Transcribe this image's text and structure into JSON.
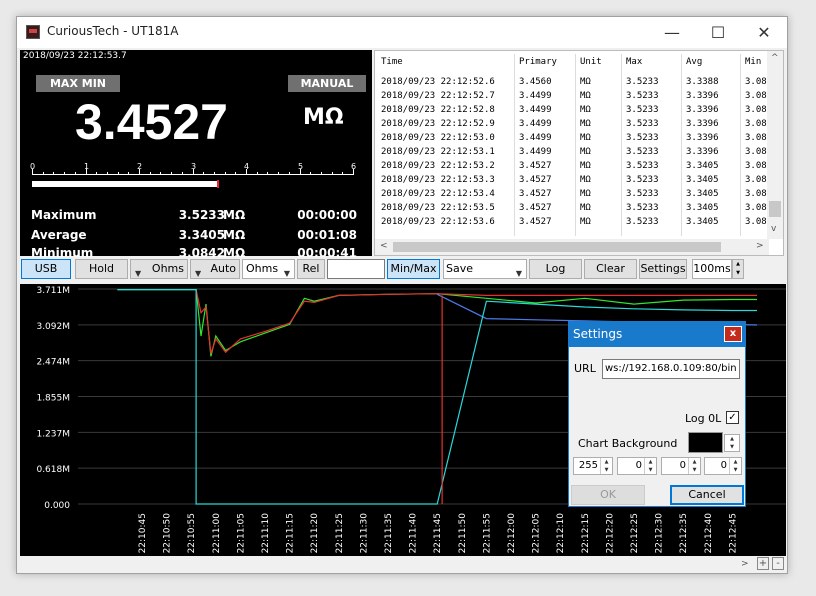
{
  "window": {
    "title": "CuriousTech - UT181A",
    "minimize": "—",
    "maximize": "☐",
    "close": "✕"
  },
  "meter": {
    "timestamp": "2018/09/23 22:12:53.7",
    "mode_badge": "MAX MIN",
    "range_badge": "MANUAL",
    "value": "3.4527",
    "unit": "MΩ",
    "scale_labels": [
      "0",
      "1",
      "2",
      "3",
      "4",
      "5",
      "6"
    ],
    "bargraph_fraction": 0.575,
    "stats": [
      {
        "label": "Maximum",
        "value": "3.5233",
        "unit": "MΩ",
        "time": "00:00:00"
      },
      {
        "label": "Average",
        "value": "3.3405",
        "unit": "MΩ",
        "time": "00:01:08"
      },
      {
        "label": "Minimum",
        "value": "3.0842",
        "unit": "MΩ",
        "time": "00:00:41"
      }
    ]
  },
  "table": {
    "columns": [
      "Time",
      "Primary",
      "Unit",
      "Max",
      "Avg",
      "Min"
    ],
    "rows": [
      [
        "2018/09/23 22:12:52.6",
        "3.4560",
        "MΩ",
        "3.5233",
        "3.3388",
        "3.08"
      ],
      [
        "2018/09/23 22:12:52.7",
        "3.4499",
        "MΩ",
        "3.5233",
        "3.3396",
        "3.08"
      ],
      [
        "2018/09/23 22:12:52.8",
        "3.4499",
        "MΩ",
        "3.5233",
        "3.3396",
        "3.08"
      ],
      [
        "2018/09/23 22:12:52.9",
        "3.4499",
        "MΩ",
        "3.5233",
        "3.3396",
        "3.08"
      ],
      [
        "2018/09/23 22:12:53.0",
        "3.4499",
        "MΩ",
        "3.5233",
        "3.3396",
        "3.08"
      ],
      [
        "2018/09/23 22:12:53.1",
        "3.4499",
        "MΩ",
        "3.5233",
        "3.3396",
        "3.08"
      ],
      [
        "2018/09/23 22:12:53.2",
        "3.4527",
        "MΩ",
        "3.5233",
        "3.3405",
        "3.08"
      ],
      [
        "2018/09/23 22:12:53.3",
        "3.4527",
        "MΩ",
        "3.5233",
        "3.3405",
        "3.08"
      ],
      [
        "2018/09/23 22:12:53.4",
        "3.4527",
        "MΩ",
        "3.5233",
        "3.3405",
        "3.08"
      ],
      [
        "2018/09/23 22:12:53.5",
        "3.4527",
        "MΩ",
        "3.5233",
        "3.3405",
        "3.08"
      ],
      [
        "2018/09/23 22:12:53.6",
        "3.4527",
        "MΩ",
        "3.5233",
        "3.3405",
        "3.08"
      ]
    ]
  },
  "toolbar": {
    "usb": "USB",
    "hold": "Hold",
    "ohms1": "Ohms",
    "auto": "Auto",
    "ohms2": "Ohms",
    "rel": "Rel",
    "rel_value": "",
    "minmax": "Min/Max",
    "save": "Save",
    "log": "Log",
    "clear": "Clear",
    "settings": "Settings",
    "interval": "100ms"
  },
  "chart_data": {
    "type": "line",
    "background": "#000000",
    "y_ticks": [
      "0.000",
      "0.618M",
      "1.237M",
      "1.855M",
      "2.474M",
      "3.092M",
      "3.711M"
    ],
    "x_ticks": [
      "22:10:45",
      "22:10:50",
      "22:10:55",
      "22:11:00",
      "22:11:05",
      "22:11:10",
      "22:11:15",
      "22:11:20",
      "22:11:25",
      "22:11:30",
      "22:11:35",
      "22:11:40",
      "22:11:45",
      "22:11:50",
      "22:11:55",
      "22:12:00",
      "22:12:05",
      "22:12:10",
      "22:12:15",
      "22:12:20",
      "22:12:25",
      "22:12:30",
      "22:12:35",
      "22:12:40",
      "22:12:45"
    ],
    "ylim": [
      0,
      3.711
    ],
    "series": [
      {
        "color": "#2ee82e",
        "x": [
          "22:10:40",
          "22:10:56",
          "22:10:57",
          "22:10:58",
          "22:10:59",
          "22:11:00",
          "22:11:02",
          "22:11:05",
          "22:11:10",
          "22:11:15",
          "22:11:18",
          "22:11:20",
          "22:11:25",
          "22:11:35",
          "22:11:45",
          "22:11:55",
          "22:12:05",
          "22:12:15",
          "22:12:25",
          "22:12:35",
          "22:12:45",
          "22:12:50"
        ],
        "y": [
          3.7,
          3.7,
          2.9,
          3.45,
          2.55,
          2.9,
          2.65,
          2.8,
          2.95,
          3.1,
          3.55,
          3.5,
          3.6,
          3.62,
          3.63,
          3.55,
          3.47,
          3.55,
          3.45,
          3.52,
          3.53,
          3.53
        ]
      },
      {
        "color": "#e83030",
        "x": [
          "22:10:56",
          "22:10:57",
          "22:10:58",
          "22:10:59",
          "22:11:00",
          "22:11:02",
          "22:11:05",
          "22:11:10",
          "22:11:15",
          "22:11:18",
          "22:11:20",
          "22:11:25",
          "22:11:35",
          "22:11:45",
          "22:11:55",
          "22:12:05",
          "22:12:15",
          "22:12:25",
          "22:12:35",
          "22:12:45",
          "22:12:50"
        ],
        "y": [
          3.7,
          3.3,
          3.4,
          2.6,
          2.85,
          2.62,
          2.85,
          2.98,
          3.12,
          3.5,
          3.48,
          3.6,
          3.62,
          3.63,
          3.6,
          3.6,
          3.6,
          3.6,
          3.6,
          3.6,
          3.6
        ]
      },
      {
        "color": "#4a7ae8",
        "x": [
          "22:11:45",
          "22:11:55",
          "22:12:05",
          "22:12:15",
          "22:12:25",
          "22:12:35",
          "22:12:45",
          "22:12:50"
        ],
        "y": [
          3.62,
          3.2,
          3.18,
          3.16,
          3.14,
          3.12,
          3.1,
          3.09
        ]
      },
      {
        "color": "#2ad8d8",
        "x": [
          "22:10:40",
          "22:10:56",
          "22:10:56",
          "22:11:45",
          "22:11:55",
          "22:12:05",
          "22:12:15",
          "22:12:25",
          "22:12:35",
          "22:12:45",
          "22:12:50"
        ],
        "y": [
          3.7,
          3.7,
          0.0,
          0.0,
          3.5,
          3.45,
          3.4,
          3.37,
          3.35,
          3.34,
          3.34
        ]
      }
    ]
  },
  "settings_dialog": {
    "title": "Settings",
    "close": "x",
    "url_label": "URL",
    "url_value": "ws://192.168.0.109:80/bin",
    "log0l_label": "Log 0L",
    "log0l_checked": "✓",
    "chart_bg_label": "Chart Background",
    "rgba": [
      "255",
      "0",
      "0",
      "0"
    ],
    "ok": "OK",
    "cancel": "Cancel"
  },
  "scroll": {
    "left": "<",
    "right": ">",
    "up": "^",
    "down": "v",
    "plus": "+",
    "minus": "-"
  }
}
